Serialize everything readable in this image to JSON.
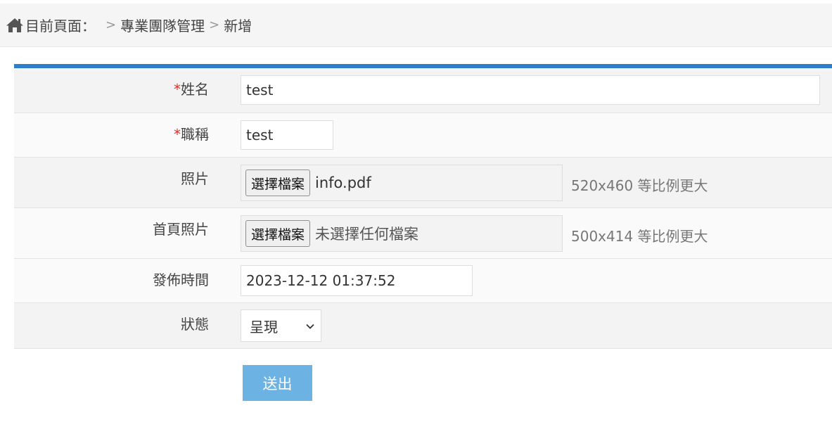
{
  "breadcrumb": {
    "prefix": "目前頁面：",
    "separator": ">",
    "items": [
      "專業團隊管理",
      "新增"
    ],
    "home_icon": "home-icon"
  },
  "colors": {
    "accent_bar": "#2d7dca",
    "submit_button": "#6cb3e3",
    "required_mark": "#d9302c"
  },
  "form": {
    "required_mark": "*",
    "name": {
      "label": "姓名",
      "value": "test"
    },
    "title": {
      "label": "職稱",
      "value": "test"
    },
    "photo": {
      "label": "照片",
      "button_label": "選擇檔案",
      "file_name": "info.pdf",
      "hint": "520x460 等比例更大"
    },
    "home_photo": {
      "label": "首頁照片",
      "button_label": "選擇檔案",
      "file_name": "未選擇任何檔案",
      "hint": "500x414 等比例更大"
    },
    "publish_time": {
      "label": "發佈時間",
      "value": "2023-12-12 01:37:52"
    },
    "status": {
      "label": "狀態",
      "selected": "呈現"
    },
    "submit_label": "送出"
  }
}
